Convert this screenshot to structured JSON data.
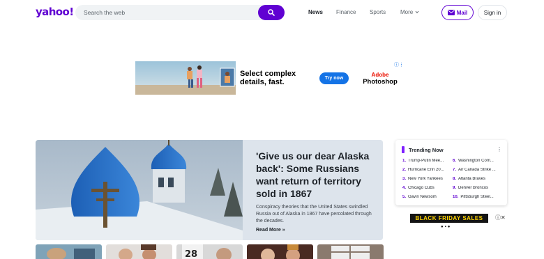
{
  "header": {
    "logo": "yahoo!",
    "search": {
      "placeholder": "Search the web"
    },
    "nav": {
      "news": "News",
      "finance": "Finance",
      "sports": "Sports",
      "more": "More"
    },
    "mail_label": "Mail",
    "signin_label": "Sign in",
    "accent_color": "#6001d2"
  },
  "ad_banner": {
    "headline": "Select complex details, fast.",
    "cta": "Try now",
    "brand_top": "Adobe",
    "brand_bottom": "Photoshop"
  },
  "hero": {
    "title": "'Give us our dear Alaska back': Some Russians want return of territory sold in 1867",
    "summary": "Conspiracy theories that the United States swindled Russia out of Alaska in 1867 have percolated through the decades.",
    "read_more": "Read More »"
  },
  "trending": {
    "title": "Trending Now",
    "items": [
      {
        "num": "1.",
        "label": "Trump-Putin Mee..."
      },
      {
        "num": "2.",
        "label": "Hurricane Erin 20..."
      },
      {
        "num": "3.",
        "label": "New York Yankees"
      },
      {
        "num": "4.",
        "label": "Chicago Cubs"
      },
      {
        "num": "5.",
        "label": "Gavin Newsom"
      },
      {
        "num": "6.",
        "label": "Washington Com..."
      },
      {
        "num": "7.",
        "label": "Air Canada Strike ..."
      },
      {
        "num": "8.",
        "label": "Atlanta Braves"
      },
      {
        "num": "9.",
        "label": "Denver Broncos"
      },
      {
        "num": "10.",
        "label": "Pittsburgh Steel..."
      }
    ]
  },
  "ad_side": {
    "banner": "BLACK FRIDAY SALES"
  },
  "thumbs": {
    "thumb3_text": "28"
  }
}
